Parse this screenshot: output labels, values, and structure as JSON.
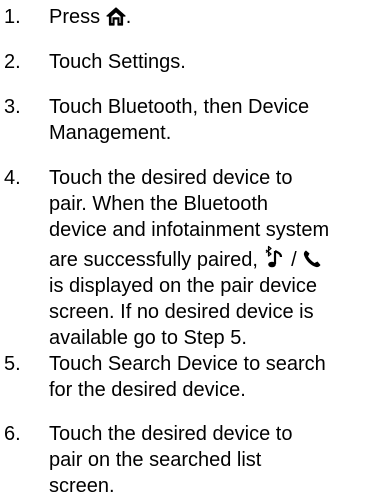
{
  "steps": [
    {
      "num": "1.",
      "lines": [
        "Press ",
        "."
      ],
      "icon": "home-icon"
    },
    {
      "num": "2.",
      "lines": [
        "Touch Settings."
      ]
    },
    {
      "num": "3.",
      "lines": [
        "Touch Bluetooth, then Device",
        "Management."
      ]
    },
    {
      "num": "4.",
      "lines": [
        "Touch the desired device to",
        "pair. When the Bluetooth",
        "device and infotainment system",
        "are successfully paired,",
        "/",
        "is displayed on the pair device",
        "screen. If no desired device is",
        "available go to Step 5."
      ],
      "icons": [
        "bluetooth-music-icon",
        "phone-icon"
      ]
    },
    {
      "num": "5.",
      "lines": [
        "Touch Search Device to search",
        "for the desired device."
      ]
    },
    {
      "num": "6.",
      "lines": [
        "Touch the desired device to",
        "pair on the searched list",
        "screen."
      ]
    }
  ]
}
